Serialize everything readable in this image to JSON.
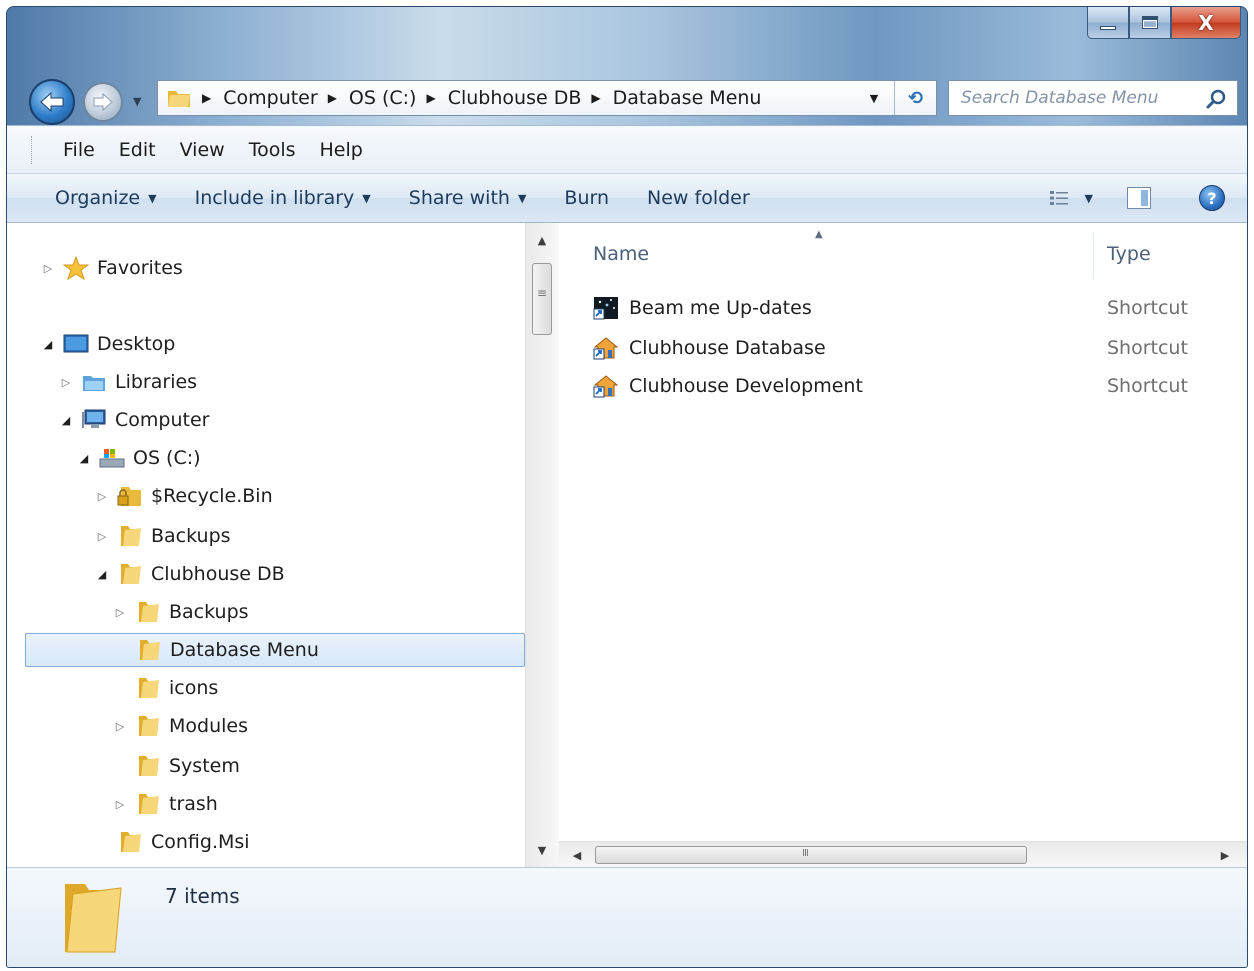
{
  "window": {
    "caption_buttons": {
      "minimize_icon": "minimize-icon",
      "maximize_icon": "maximize-icon",
      "close_glyph": "X"
    }
  },
  "address": {
    "crumbs": [
      "Computer",
      "OS (C:)",
      "Clubhouse DB",
      "Database Menu"
    ],
    "separator": "▶",
    "dropdown_glyph": "▼",
    "refresh_glyph": "⟲",
    "search_placeholder": "Search Database Menu"
  },
  "menu": {
    "items": [
      "File",
      "Edit",
      "View",
      "Tools",
      "Help"
    ]
  },
  "toolbar": {
    "organize": "Organize",
    "include_in_library": "Include in library",
    "share_with": "Share with",
    "burn": "Burn",
    "new_folder": "New folder",
    "caret": "▼",
    "help_glyph": "?"
  },
  "nav_tree": {
    "items": [
      {
        "label": "Favorites",
        "icon": "star-icon",
        "expander": "▷"
      },
      {
        "label": "Desktop",
        "icon": "desktop-icon",
        "expander": "◢"
      },
      {
        "label": "Libraries",
        "icon": "libraries-icon",
        "expander": "▷"
      },
      {
        "label": "Computer",
        "icon": "computer-icon",
        "expander": "◢"
      },
      {
        "label": "OS (C:)",
        "icon": "drive-icon",
        "expander": "◢"
      },
      {
        "label": "$Recycle.Bin",
        "icon": "locked-folder-icon",
        "expander": "▷"
      },
      {
        "label": "Backups",
        "icon": "folder-icon",
        "expander": "▷"
      },
      {
        "label": "Clubhouse DB",
        "icon": "folder-icon",
        "expander": "◢"
      },
      {
        "label": "Backups",
        "icon": "folder-icon",
        "expander": "▷"
      },
      {
        "label": "Database Menu",
        "icon": "folder-icon",
        "expander": "",
        "selected": true
      },
      {
        "label": "icons",
        "icon": "folder-icon",
        "expander": ""
      },
      {
        "label": "Modules",
        "icon": "folder-icon",
        "expander": "▷"
      },
      {
        "label": "System",
        "icon": "folder-icon",
        "expander": ""
      },
      {
        "label": "trash",
        "icon": "folder-icon",
        "expander": "▷"
      },
      {
        "label": "Config.Msi",
        "icon": "folder-icon",
        "expander": ""
      }
    ],
    "scroll_up": "▲",
    "scroll_down": "▼"
  },
  "content": {
    "columns": {
      "name": "Name",
      "type": "Type",
      "sort_glyph": "▲"
    },
    "files": [
      {
        "name": "Beam me Up-dates",
        "type": "Shortcut",
        "icon": "app-shortcut-icon"
      },
      {
        "name": "Clubhouse Database",
        "type": "Shortcut",
        "icon": "house-shortcut-icon"
      },
      {
        "name": "Clubhouse Development",
        "type": "Shortcut",
        "icon": "house-shortcut-icon"
      }
    ],
    "hscroll_left": "◀",
    "hscroll_right": "▶"
  },
  "details": {
    "count_text": "7 items",
    "icon": "folder-icon"
  },
  "colors": {
    "frame_blue": "#6f97c1",
    "selection_bg": "#d7e8f9",
    "selection_border": "#84acd6",
    "toolbar_text": "#1f3b5b",
    "folder_yellow": "#f0c75a"
  }
}
